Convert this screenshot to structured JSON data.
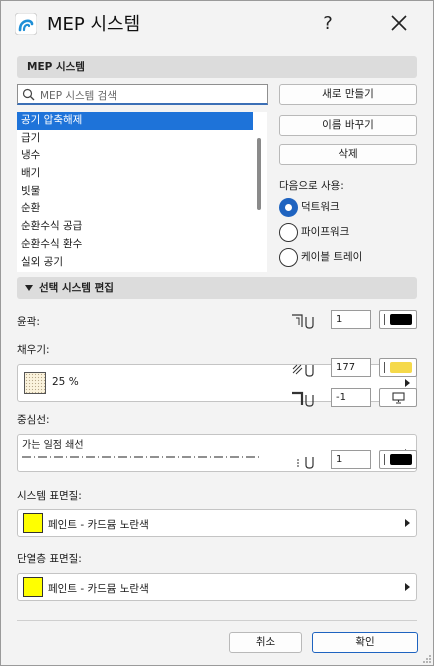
{
  "window": {
    "title": "MEP 시스템",
    "help_label": "?"
  },
  "systems_panel": {
    "header": "MEP 시스템",
    "search_placeholder": "MEP 시스템 검색",
    "items": [
      "공기 압축해제",
      "급기",
      "냉수",
      "배기",
      "빗물",
      "순환",
      "순환수식 공급",
      "순환수식 환수",
      "실외 공기"
    ],
    "selected_index": 0,
    "buttons": {
      "new": "새로 만들기",
      "rename": "이름 바꾸기",
      "delete": "삭제"
    },
    "use_as_label": "다음으로 사용:",
    "use_as_options": [
      "덕트워크",
      "파이프워크",
      "케이블 트레이"
    ],
    "use_as_selected": 0
  },
  "edit_panel": {
    "header": "선택 시스템 편집",
    "outline_label": "윤곽:",
    "outline_pen": "1",
    "outline_pen_color": "#000000",
    "fill_label": "채우기:",
    "fill_name": "25 %",
    "fill_pen": "177",
    "fill_pen_color": "#f5d94a",
    "fill_bg_pen": "-1",
    "centerline_label": "중심선:",
    "centerline_name": "가는 일점 쇄선",
    "centerline_pen": "1",
    "centerline_pen_color": "#000000",
    "system_surface_label": "시스템 표면질:",
    "system_surface_name": "페인트 - 카드뮴 노란색",
    "insulation_surface_label": "단열층 표면질:",
    "insulation_surface_name": "페인트 - 카드뮴 노란색",
    "surface_color": "#ffff00"
  },
  "footer": {
    "cancel": "취소",
    "ok": "확인"
  }
}
